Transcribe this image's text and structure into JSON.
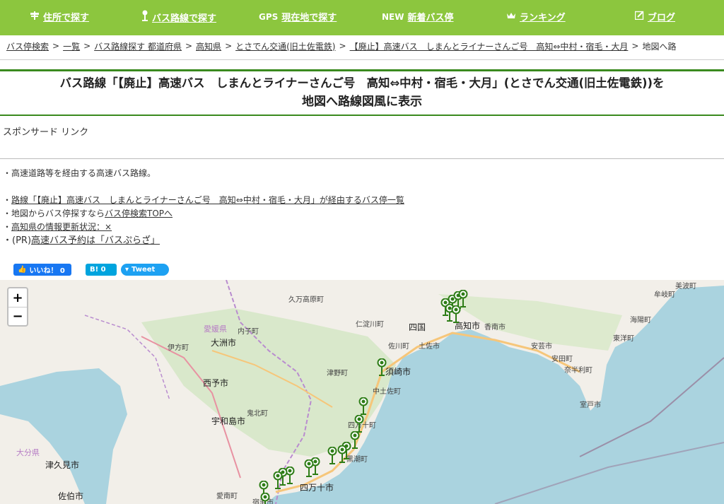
{
  "nav": {
    "items": [
      {
        "prefix": "",
        "label": "住所で探す",
        "icon": "signpost-icon"
      },
      {
        "prefix": "",
        "label": "バス路線で探す",
        "icon": "bus-stop-icon"
      },
      {
        "prefix": "GPS",
        "label": "現在地で探す",
        "icon": ""
      },
      {
        "prefix": "NEW",
        "label": "新着バス停",
        "icon": ""
      },
      {
        "prefix": "",
        "label": "ランキング",
        "icon": "crown-icon"
      },
      {
        "prefix": "",
        "label": "ブログ",
        "icon": "edit-icon"
      }
    ],
    "bg_color": "#8cc63e"
  },
  "breadcrumb": {
    "items": [
      "バス停検索",
      "一覧",
      "バス路線探す 都道府県",
      "高知県",
      "とさでん交通(旧土佐電鉄)",
      "【廃止】高速バス　しまんとライナーさんご号　高知⇔中村・宿毛・大月"
    ],
    "separator": ">",
    "current": "地図へ路"
  },
  "heading": {
    "line1": "バス路線「【廃止】高速バス　しまんとライナーさんご号　高知⇔中村・宿毛・大月」(とさでん交通(旧土佐電鉄))を",
    "line2": "地図へ路線図風に表示"
  },
  "sponsor": "スポンサード リンク",
  "info": {
    "note": "・高速道路等を経由する高速バス路線。",
    "links": [
      {
        "prefix": "・",
        "text": "路線「【廃止】高速バス　しまんとライナーさんご号　高知⇔中村・宿毛・大月」が経由するバス停一覧",
        "suffix": ""
      },
      {
        "prefix": "・地図からバス停探すなら",
        "text": "バス停検索TOPへ",
        "suffix": ""
      },
      {
        "prefix": "・",
        "text": "高知県の情報更新状況：×",
        "suffix": ""
      },
      {
        "prefix": "・(PR)",
        "text": "高速バス予約は「バスぷらざ」",
        "suffix": ""
      }
    ]
  },
  "social": {
    "like": "いいね！ 0",
    "hatena": "B! 0",
    "tweet": "Tweet"
  },
  "map": {
    "zoom_in": "+",
    "zoom_out": "−",
    "labels": [
      "久万高原町",
      "愛媛県",
      "内子町",
      "大洲市",
      "伊方町",
      "仁淀川町",
      "四国",
      "香南市",
      "高知市",
      "佐川町",
      "土佐市",
      "安芸市",
      "東洋町",
      "海陽町",
      "須崎市",
      "津野町",
      "中土佐町",
      "西予市",
      "鬼北町",
      "宇和島市",
      "四万十町",
      "黒潮町",
      "四万十市",
      "愛南町",
      "宿毛市",
      "大分県",
      "津久見市",
      "佐伯市",
      "室戸市",
      "奈半利町",
      "安田町",
      "牟岐町",
      "美波町"
    ]
  }
}
